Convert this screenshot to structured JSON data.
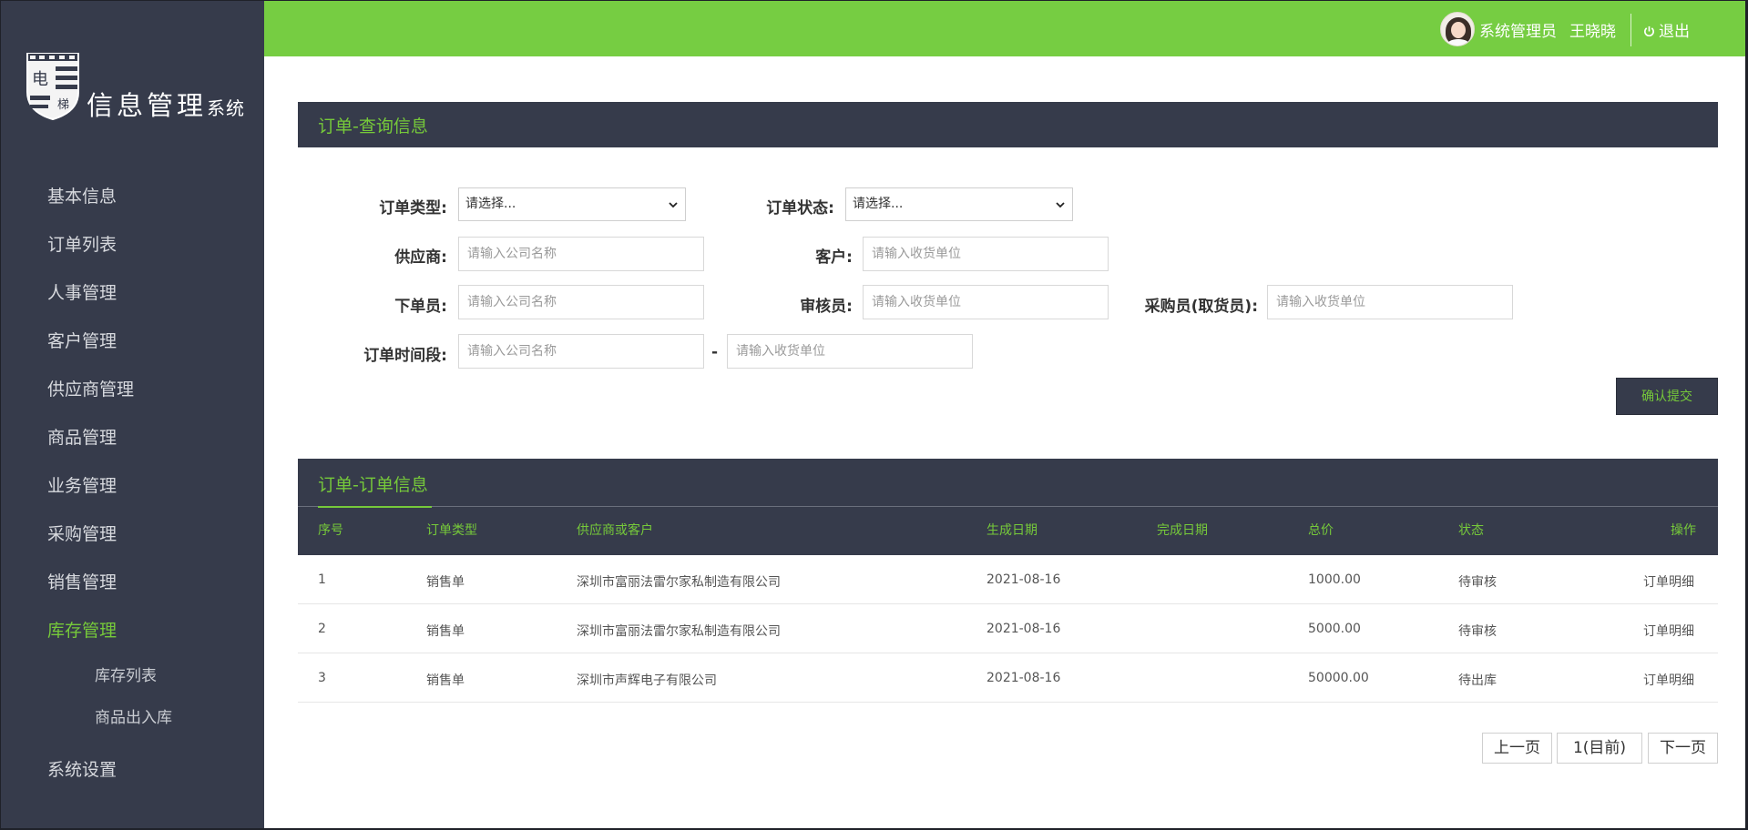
{
  "logo": {
    "badge_text_top": "电",
    "badge_text_bottom": "梯",
    "title_main": "信息管理",
    "title_tail": "系统"
  },
  "topbar": {
    "role": "系统管理员",
    "user": "王晓晓",
    "logout": "退出"
  },
  "sidebar": {
    "items": [
      {
        "label": "基本信息"
      },
      {
        "label": "订单列表"
      },
      {
        "label": "人事管理"
      },
      {
        "label": "客户管理"
      },
      {
        "label": "供应商管理"
      },
      {
        "label": "商品管理"
      },
      {
        "label": "业务管理"
      },
      {
        "label": "采购管理"
      },
      {
        "label": "销售管理"
      },
      {
        "label": "库存管理",
        "active": true
      }
    ],
    "sub_items": [
      {
        "label": "库存列表"
      },
      {
        "label": "商品出入库"
      }
    ],
    "settings": {
      "label": "系统设置"
    }
  },
  "query_panel": {
    "title": "订单-查询信息",
    "order_type": {
      "label": "订单类型:",
      "selected": "请选择..."
    },
    "order_status": {
      "label": "订单状态:",
      "selected": "请选择..."
    },
    "supplier": {
      "label": "供应商:",
      "placeholder": "请输入公司名称",
      "value": ""
    },
    "customer": {
      "label": "客户:",
      "placeholder": "请输入收货单位",
      "value": ""
    },
    "orderer": {
      "label": "下单员:",
      "placeholder": "请输入公司名称",
      "value": ""
    },
    "auditor": {
      "label": "审核员:",
      "placeholder": "请输入收货单位",
      "value": ""
    },
    "buyer": {
      "label": "采购员(取货员):",
      "placeholder": "请输入收货单位",
      "value": ""
    },
    "period": {
      "label": "订单时间段:",
      "start_placeholder": "请输入公司名称",
      "end_placeholder": "请输入收货单位",
      "separator": "-"
    },
    "submit": "确认提交"
  },
  "order_panel": {
    "title": "订单-订单信息",
    "columns": [
      "序号",
      "订单类型",
      "供应商或客户",
      "生成日期",
      "完成日期",
      "总价",
      "状态",
      "操作"
    ],
    "rows": [
      {
        "no": "1",
        "type": "销售单",
        "party": "深圳市富丽法雷尔家私制造有限公司",
        "created": "2021-08-16",
        "finished": "",
        "total": "1000.00",
        "status": "待审核",
        "action": "订单明细"
      },
      {
        "no": "2",
        "type": "销售单",
        "party": "深圳市富丽法雷尔家私制造有限公司",
        "created": "2021-08-16",
        "finished": "",
        "total": "5000.00",
        "status": "待审核",
        "action": "订单明细"
      },
      {
        "no": "3",
        "type": "销售单",
        "party": "深圳市声辉电子有限公司",
        "created": "2021-08-16",
        "finished": "",
        "total": "50000.00",
        "status": "待出库",
        "action": "订单明细"
      }
    ]
  },
  "pagination": {
    "prev": "上一页",
    "current": "1(目前)",
    "next": "下一页"
  },
  "colors": {
    "sidebar_bg": "#363b4b",
    "accent_green": "#76cd42",
    "accent_text_green": "#76c93a"
  }
}
